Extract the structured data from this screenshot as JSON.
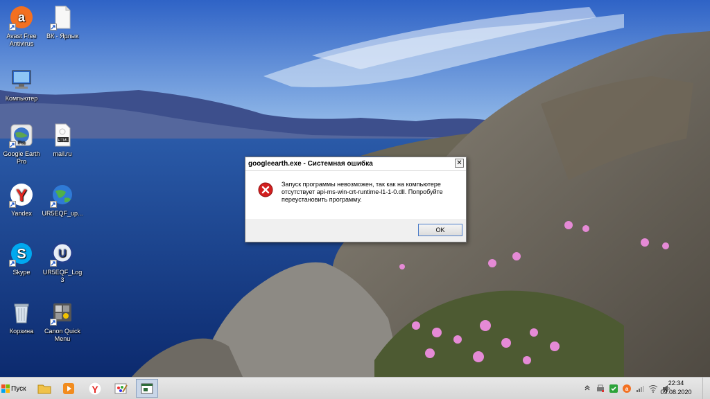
{
  "desktop": {
    "icons": [
      {
        "label": "Avast Free Antivirus",
        "icon": "avast-icon"
      },
      {
        "label": "ВК - Ярлык",
        "icon": "blank-file-icon"
      },
      {
        "label": "Компьютер",
        "icon": "computer-icon"
      },
      {
        "label": "Google Earth Pro",
        "icon": "google-earth-icon"
      },
      {
        "label": "mail.ru",
        "icon": "html-file-icon"
      },
      {
        "label": "Yandex",
        "icon": "yandex-browser-icon"
      },
      {
        "label": "UR5EQF_up...",
        "icon": "globe-icon"
      },
      {
        "label": "Skype",
        "icon": "skype-icon"
      },
      {
        "label": "UR5EQF_Log 3",
        "icon": "log-app-icon"
      },
      {
        "label": "Корзина",
        "icon": "recycle-bin-icon"
      },
      {
        "label": "Canon Quick Menu",
        "icon": "canon-quick-menu-icon"
      }
    ]
  },
  "dialog": {
    "title": "googleearth.exe - Системная ошибка",
    "close_label": "✕",
    "message": "Запуск программы невозможен, так как на компьютере отсутствует api-ms-win-crt-runtime-l1-1-0.dll. Попробуйте переустановить программу.",
    "ok_label": "OK",
    "icon": "error-icon"
  },
  "taskbar": {
    "start_label": "Пуск",
    "pinned": [
      {
        "icon": "file-explorer-icon"
      },
      {
        "icon": "media-player-icon"
      },
      {
        "icon": "yandex-browser-icon"
      },
      {
        "icon": "paint-icon"
      },
      {
        "icon": "error-window-icon",
        "active": true
      }
    ],
    "tray_icons": [
      "show-hidden-icons-chevron",
      "printer-icon",
      "shield-check-icon",
      "avast-tray-icon",
      "volume-icon",
      "network-icon",
      "speaker-icon"
    ],
    "time": "22:34",
    "date": "09.08.2020"
  },
  "colors": {
    "error_red": "#d21f1f",
    "taskbar": "#dcdcdc",
    "sky": "#3a6fc7"
  }
}
